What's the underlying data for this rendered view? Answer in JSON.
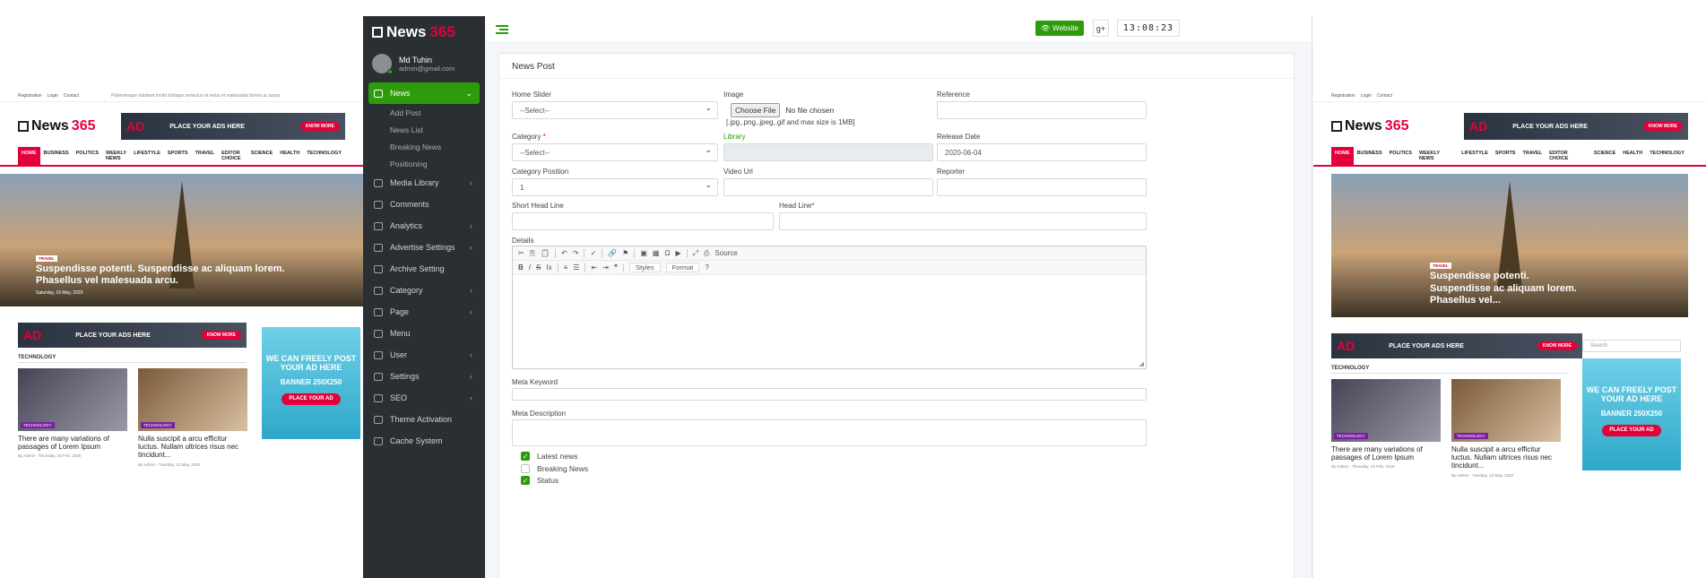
{
  "site_left": {
    "topbar": [
      "Registration",
      "Login",
      "Contact"
    ],
    "topbar_text": "Pellentesque habitant morbi tristique senectus et netus et malesuada fames ac turpis",
    "logo_a": "News",
    "logo_b": "365",
    "ad_label": "AD",
    "ad_text": "PLACE YOUR ADS HERE",
    "ad_button": "KNOW MORE",
    "nav": [
      "HOME",
      "BUSINESS",
      "POLITICS",
      "WEEKLY NEWS",
      "LIFESTYLE",
      "SPORTS",
      "TRAVEL",
      "EDITOR CHOICE",
      "SCIENCE",
      "HEALTH",
      "TECHNOLOGY"
    ],
    "hero_tag": "TRAVEL",
    "hero_title": "Suspendisse potenti. Suspendisse ac aliquam lorem. Phasellus vel malesuada arcu.",
    "hero_meta": "Saturday, 16 May, 2020",
    "section": "TECHNOLOGY",
    "cards": [
      {
        "tag": "TECHNOLOGY",
        "title": "There are many variations of passages of Lorem Ipsum",
        "meta": "By Admin - Thursday, 23 Feb, 2020"
      },
      {
        "tag": "TECHNOLOGY",
        "title": "Nulla suscipit a arcu efficitur luctus. Nullam ultrices risus nec tincidunt...",
        "meta": "By Admin - Tuesday, 12 May, 2020"
      }
    ],
    "side_ad_title": "WE CAN FREELY POST YOUR AD HERE",
    "side_ad_banner": "BANNER 250X250",
    "side_ad_button": "PLACE YOUR AD"
  },
  "admin": {
    "logo_a": "News",
    "logo_b": "365",
    "user_name": "Md Tuhin",
    "user_email": "admin@gmail.com",
    "menu": [
      {
        "label": "News",
        "active": true
      },
      {
        "label": "Media Library"
      },
      {
        "label": "Comments"
      },
      {
        "label": "Analytics"
      },
      {
        "label": "Advertise Settings"
      },
      {
        "label": "Archive Setting"
      },
      {
        "label": "Category"
      },
      {
        "label": "Page"
      },
      {
        "label": "Menu"
      },
      {
        "label": "User"
      },
      {
        "label": "Settings"
      },
      {
        "label": "SEO"
      },
      {
        "label": "Theme Activation"
      },
      {
        "label": "Cache System"
      }
    ],
    "submenu": [
      "Add Post",
      "News List",
      "Breaking News",
      "Positioning"
    ],
    "website_button": "Website",
    "google_button": "g+",
    "clock": "13:08:23",
    "panel_title": "News Post",
    "form": {
      "home_slider_label": "Home Slider",
      "home_slider_value": "--Select--",
      "image_label": "Image",
      "choose_file": "Choose File",
      "no_file": "No file chosen",
      "image_hint": "[.jpg,.png,.jpeg,.gif and max size is 1MB]",
      "reference_label": "Reference",
      "category_label": "Category",
      "category_value": "--Select--",
      "library_label": "Library",
      "release_date_label": "Release Date",
      "release_date_value": "2020-06-04",
      "category_position_label": "Category Position",
      "category_position_value": "1",
      "video_url_label": "Video Url",
      "reporter_label": "Reporter",
      "short_headline_label": "Short Head Line",
      "headline_label": "Head Line",
      "details_label": "Details",
      "source_button": "Source",
      "styles_dropdown": "Styles",
      "format_dropdown": "Format",
      "meta_keyword_label": "Meta Keyword",
      "meta_description_label": "Meta Description",
      "checks": [
        {
          "label": "Latest news",
          "checked": true
        },
        {
          "label": "Breaking News",
          "checked": false
        },
        {
          "label": "Status",
          "checked": true
        }
      ]
    }
  },
  "site_right": {
    "topbar": [
      "Registration",
      "Login",
      "Contact"
    ],
    "logo_a": "News",
    "logo_b": "365",
    "ad_label": "AD",
    "ad_text": "PLACE YOUR ADS HERE",
    "ad_button": "KNOW MORE",
    "nav": [
      "HOME",
      "BUSINESS",
      "POLITICS",
      "WEEKLY NEWS",
      "LIFESTYLE",
      "SPORTS",
      "TRAVEL",
      "EDITOR CHOICE",
      "SCIENCE",
      "HEALTH",
      "TECHNOLOGY"
    ],
    "hero_tag": "TRAVEL",
    "hero_title": "Suspendisse potenti. Suspendisse ac aliquam lorem. Phasellus vel...",
    "section": "TECHNOLOGY",
    "cards": [
      {
        "tag": "TECHNOLOGY",
        "title": "There are many variations of passages of Lorem Ipsum",
        "meta": "By Admin - Thursday, 23 Feb, 2020"
      },
      {
        "tag": "TECHNOLOGY",
        "title": "Nulla suscipit a arcu efficitur luctus. Nullam ultrices risus nec tincidunt...",
        "meta": "By Admin - Tuesday, 12 May, 2020"
      }
    ],
    "side_ad_title": "WE CAN FREELY POST YOUR AD HERE",
    "side_ad_banner": "BANNER 250X250",
    "side_ad_button": "PLACE YOUR AD",
    "search_placeholder": "Search"
  },
  "colors": {
    "accent": "#2e9b0b",
    "brand_red": "#e4003a",
    "sidebar": "#2a2f34"
  }
}
